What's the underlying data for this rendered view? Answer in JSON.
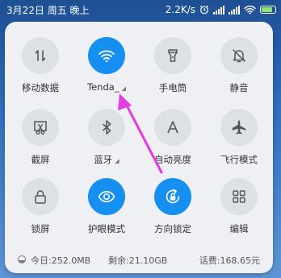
{
  "status": {
    "datetime": "3月22日 周五 晚上",
    "speed": "2.2K/s"
  },
  "tiles": [
    {
      "key": "mobile-data",
      "label": "移动数据",
      "icon": "mobile-data-icon",
      "active": false
    },
    {
      "key": "wifi",
      "label": "Tenda_",
      "icon": "wifi-icon",
      "active": true
    },
    {
      "key": "flashlight",
      "label": "手电筒",
      "icon": "flashlight-icon",
      "active": false
    },
    {
      "key": "mute",
      "label": "静音",
      "icon": "bell-off-icon",
      "active": false
    },
    {
      "key": "screenshot",
      "label": "截屏",
      "icon": "scissors-icon",
      "active": false
    },
    {
      "key": "bluetooth",
      "label": "蓝牙",
      "icon": "bluetooth-icon",
      "active": false
    },
    {
      "key": "auto-brightness",
      "label": "自动亮度",
      "icon": "letter-a-icon",
      "active": false
    },
    {
      "key": "airplane",
      "label": "飞行模式",
      "icon": "airplane-icon",
      "active": false
    },
    {
      "key": "lock-screen",
      "label": "锁屏",
      "icon": "lock-icon",
      "active": false
    },
    {
      "key": "eye-care",
      "label": "护眼模式",
      "icon": "eye-icon",
      "active": true
    },
    {
      "key": "rotation-lock",
      "label": "方向锁定",
      "icon": "rotation-lock-icon",
      "active": true
    },
    {
      "key": "edit",
      "label": "编辑",
      "icon": "grid-icon",
      "active": false
    }
  ],
  "footer": {
    "today": "今日:252.0MB",
    "remaining": "剩余:21.10GB",
    "fee": "话费:168.65元"
  },
  "colors": {
    "accent": "#1590f0",
    "annotation": "#e23ddf"
  }
}
